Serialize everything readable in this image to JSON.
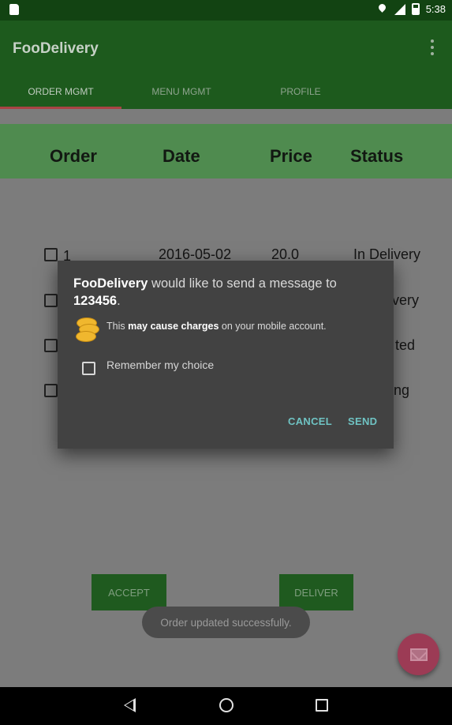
{
  "status_bar": {
    "time": "5:38"
  },
  "app": {
    "title": "FooDelivery"
  },
  "tabs": [
    {
      "label": "ORDER MGMT",
      "active": true
    },
    {
      "label": "MENU MGMT",
      "active": false
    },
    {
      "label": "PROFILE",
      "active": false
    }
  ],
  "table": {
    "headers": {
      "order": "Order",
      "date": "Date",
      "price": "Price",
      "status": "Status"
    },
    "rows": [
      {
        "id": "1",
        "date": "2016-05-02",
        "price": "20.0",
        "status": "In Delivery"
      },
      {
        "id": "",
        "date": "",
        "price": "",
        "status": "very"
      },
      {
        "id": "",
        "date": "",
        "price": "",
        "status": "ted"
      },
      {
        "id": "",
        "date": "",
        "price": "",
        "status": "ng"
      }
    ]
  },
  "actions": {
    "accept": "ACCEPT",
    "deliver": "DELIVER"
  },
  "toast": "Order updated successfully.",
  "dialog": {
    "app_name": "FooDelivery",
    "message_mid": " would like to send a message to ",
    "number": "123456",
    "message_end": ".",
    "warn_pre": "This ",
    "warn_bold": "may cause charges",
    "warn_post": " on your mobile account.",
    "remember_label": "Remember my choice",
    "cancel": "CANCEL",
    "send": "SEND"
  },
  "colors": {
    "primary_dark": "#124312",
    "primary": "#1d5a1d",
    "accent": "#9c3b55",
    "dialog_button": "#6fc3c3"
  },
  "icons": [
    "sd-card-icon",
    "location-icon",
    "signal-icon",
    "battery-icon",
    "overflow-menu-icon",
    "coins-icon",
    "mail-icon",
    "back-icon",
    "home-icon",
    "recents-icon"
  ]
}
